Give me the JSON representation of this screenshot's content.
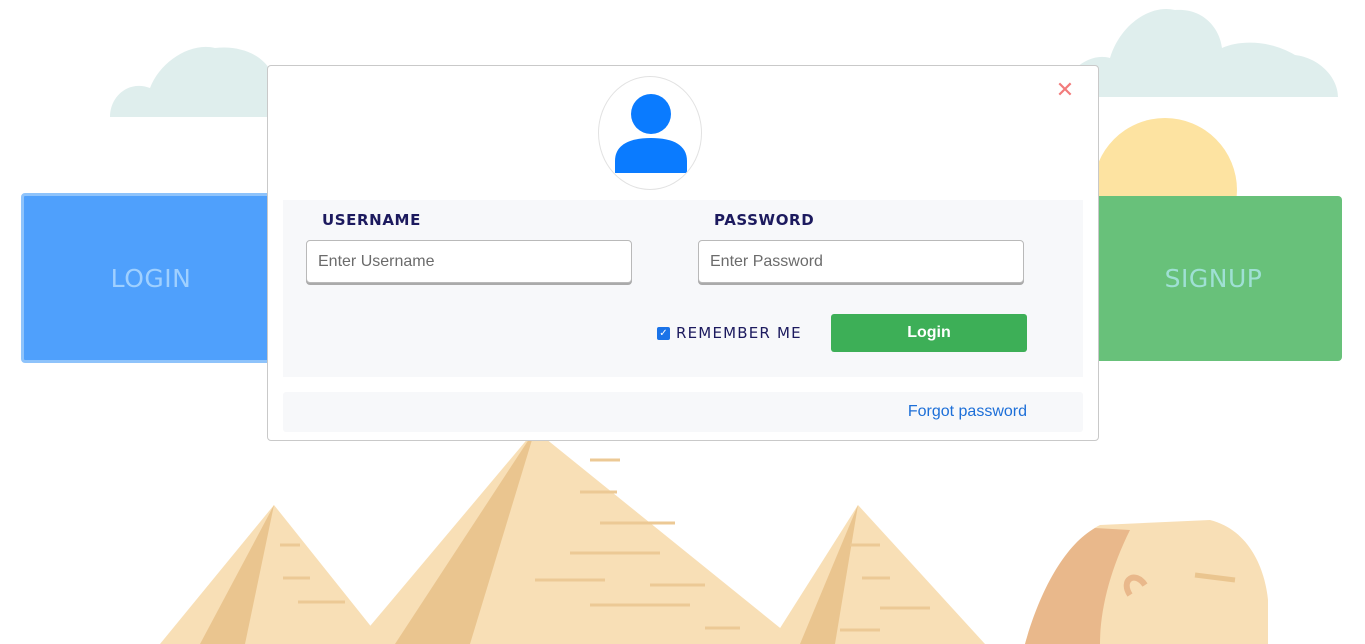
{
  "background": {
    "login_tile": "LOGIN",
    "signup_tile": "SIGNUP"
  },
  "modal": {
    "close_icon": "close-icon",
    "avatar_icon": "user-icon",
    "username_label": "USERNAME",
    "username_placeholder": "Enter Username",
    "password_label": "PASSWORD",
    "password_placeholder": "Enter Password",
    "remember_label": "REMEMBER ME",
    "remember_checked": true,
    "login_button": "Login",
    "forgot_link": "Forgot password"
  },
  "colors": {
    "login_tile": "#4fa0fc",
    "signup_tile": "#68c17a",
    "submit_button": "#3daf57",
    "label_text": "#1c1a5e",
    "link": "#1d6fd8",
    "close": "#f27b7b"
  }
}
